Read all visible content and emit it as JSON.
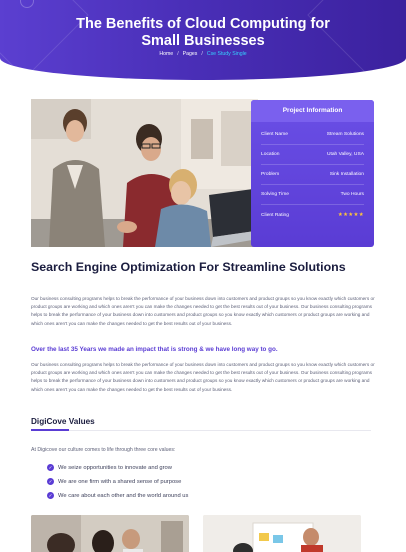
{
  "hero": {
    "title_line1": "The Benefits of Cloud Computing for",
    "title_line2": "Small Businesses",
    "breadcrumbs": [
      "Home",
      "Pages",
      "Cse Study Single"
    ]
  },
  "project_info": {
    "title": "Project Information",
    "rows": [
      {
        "label": "Client Name",
        "value": "Stream Solutions"
      },
      {
        "label": "Location",
        "value": "Utah Valley, USA"
      },
      {
        "label": "Problem",
        "value": "Sink Installation"
      },
      {
        "label": "Solving Time",
        "value": "Two Hours"
      },
      {
        "label": "Client Rating",
        "value": "★★★★★"
      }
    ],
    "rating_color": "#ffc43a"
  },
  "content": {
    "heading": "Search Engine Optimization For Streamline Solutions",
    "para1": "Our business consulting programs helps to break the performance of your business down into customers and product groups so you know exactly which customers or product groups are working and which ones aren't you can make the changes needed to get the best results out of your business. Our business consulting programs helps to break the performance of your business down into customers and product groups so you know exactly which customers or product groups are working and which ones aren't you can make the changes needed to get the best results out of your business.",
    "highlight": "Over the last 35 Years we made an impact that is strong & we have long way to go.",
    "para2": "Our business consulting programs helps to break the performance of your business down into customers and product groups so you know exactly which customers or product groups are working and which ones aren't you can make the changes needed to get the best results out of your business. Our business consulting programs helps to break the performance of your business down into customers and product groups so you know exactly which customers or product groups are working and which ones aren't you can make the changes needed to get the best results out of your business.",
    "values_heading": "DigiCove Values",
    "values_intro": "At Digicove our culture comes to life through three core values:",
    "values": [
      "We seize opportunities to innovate and grow",
      "We are one firm with a shared sense of purpose",
      "We care about each other and the world around us"
    ]
  },
  "colors": {
    "accent": "#5a3cd4",
    "highlight": "#5a3cd4",
    "breadcrumb_active": "#35d0ff"
  },
  "icons": {
    "value_bullet": "check-circle-icon",
    "rating": "star-icon"
  }
}
